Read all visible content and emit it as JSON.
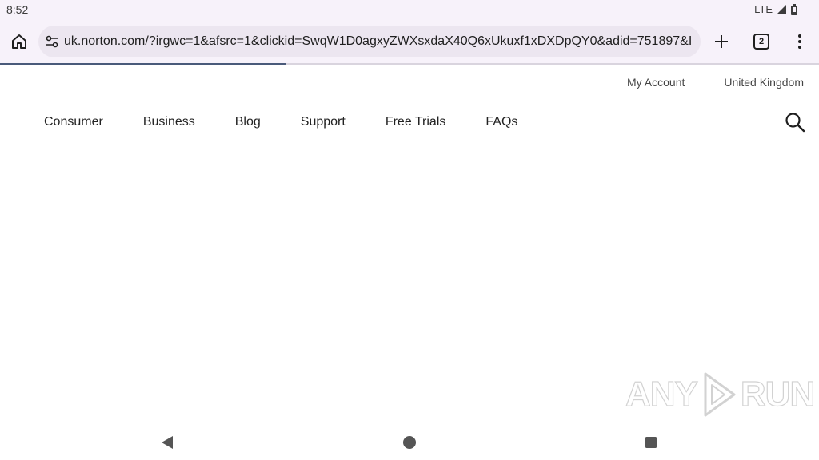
{
  "status_bar": {
    "time": "8:52",
    "network": "LTE",
    "icons": [
      "signal-icon",
      "battery-icon"
    ]
  },
  "browser": {
    "url": "uk.norton.com/?irgwc=1&afsrc=1&clickid=SwqW1D0agxyZWXsxdaX40Q6xUkuxf1xDXDpQY0&adid=751897&I",
    "tab_count": "2",
    "load_progress": 0.35,
    "icons": [
      "home-icon",
      "site-info-icon",
      "plus-icon",
      "tab-switcher-icon",
      "more-vert-icon"
    ]
  },
  "utility_nav": {
    "account": "My Account",
    "region": "United Kingdom"
  },
  "main_nav": {
    "items": [
      "Consumer",
      "Business",
      "Blog",
      "Support",
      "Free Trials",
      "FAQs"
    ],
    "search_icon": "search-icon"
  },
  "watermark": {
    "left": "ANY",
    "right": "RUN"
  },
  "system_nav": {
    "icons": [
      "back-icon",
      "home-circle-icon",
      "recents-icon"
    ]
  }
}
